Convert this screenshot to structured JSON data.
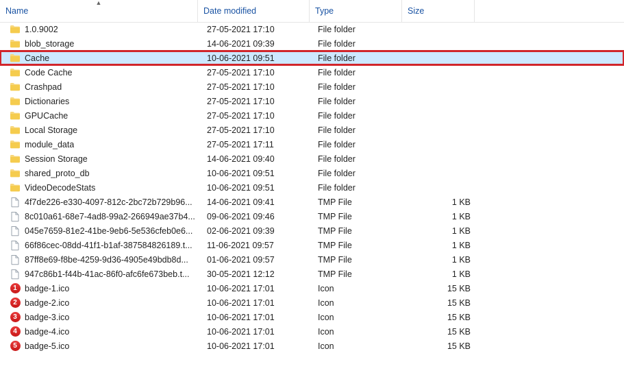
{
  "columns": {
    "name": "Name",
    "date": "Date modified",
    "type": "Type",
    "size": "Size"
  },
  "sort": {
    "column": "name",
    "direction": "asc"
  },
  "icons": {
    "folder": "folder-icon",
    "file": "file-icon",
    "badge": "badge-icon"
  },
  "items": [
    {
      "icon": "folder",
      "name": "1.0.9002",
      "date": "27-05-2021 17:10",
      "type": "File folder",
      "size": ""
    },
    {
      "icon": "folder",
      "name": "blob_storage",
      "date": "14-06-2021 09:39",
      "type": "File folder",
      "size": ""
    },
    {
      "icon": "folder",
      "name": "Cache",
      "date": "10-06-2021 09:51",
      "type": "File folder",
      "size": "",
      "selected": true,
      "highlight": true
    },
    {
      "icon": "folder",
      "name": "Code Cache",
      "date": "27-05-2021 17:10",
      "type": "File folder",
      "size": ""
    },
    {
      "icon": "folder",
      "name": "Crashpad",
      "date": "27-05-2021 17:10",
      "type": "File folder",
      "size": ""
    },
    {
      "icon": "folder",
      "name": "Dictionaries",
      "date": "27-05-2021 17:10",
      "type": "File folder",
      "size": ""
    },
    {
      "icon": "folder",
      "name": "GPUCache",
      "date": "27-05-2021 17:10",
      "type": "File folder",
      "size": ""
    },
    {
      "icon": "folder",
      "name": "Local Storage",
      "date": "27-05-2021 17:10",
      "type": "File folder",
      "size": ""
    },
    {
      "icon": "folder",
      "name": "module_data",
      "date": "27-05-2021 17:11",
      "type": "File folder",
      "size": ""
    },
    {
      "icon": "folder",
      "name": "Session Storage",
      "date": "14-06-2021 09:40",
      "type": "File folder",
      "size": ""
    },
    {
      "icon": "folder",
      "name": "shared_proto_db",
      "date": "10-06-2021 09:51",
      "type": "File folder",
      "size": ""
    },
    {
      "icon": "folder",
      "name": "VideoDecodeStats",
      "date": "10-06-2021 09:51",
      "type": "File folder",
      "size": ""
    },
    {
      "icon": "file",
      "name": "4f7de226-e330-4097-812c-2bc72b729b96...",
      "date": "14-06-2021 09:41",
      "type": "TMP File",
      "size": "1 KB"
    },
    {
      "icon": "file",
      "name": "8c010a61-68e7-4ad8-99a2-266949ae37b4...",
      "date": "09-06-2021 09:46",
      "type": "TMP File",
      "size": "1 KB"
    },
    {
      "icon": "file",
      "name": "045e7659-81e2-41be-9eb6-5e536cfeb0e6...",
      "date": "02-06-2021 09:39",
      "type": "TMP File",
      "size": "1 KB"
    },
    {
      "icon": "file",
      "name": "66f86cec-08dd-41f1-b1af-387584826189.t...",
      "date": "11-06-2021 09:57",
      "type": "TMP File",
      "size": "1 KB"
    },
    {
      "icon": "file",
      "name": "87ff8e69-f8be-4259-9d36-4905e49bdb8d...",
      "date": "01-06-2021 09:57",
      "type": "TMP File",
      "size": "1 KB"
    },
    {
      "icon": "file",
      "name": "947c86b1-f44b-41ac-86f0-afc6fe673beb.t...",
      "date": "30-05-2021 12:12",
      "type": "TMP File",
      "size": "1 KB"
    },
    {
      "icon": "badge",
      "badge": "1",
      "name": "badge-1.ico",
      "date": "10-06-2021 17:01",
      "type": "Icon",
      "size": "15 KB"
    },
    {
      "icon": "badge",
      "badge": "2",
      "name": "badge-2.ico",
      "date": "10-06-2021 17:01",
      "type": "Icon",
      "size": "15 KB"
    },
    {
      "icon": "badge",
      "badge": "3",
      "name": "badge-3.ico",
      "date": "10-06-2021 17:01",
      "type": "Icon",
      "size": "15 KB"
    },
    {
      "icon": "badge",
      "badge": "4",
      "name": "badge-4.ico",
      "date": "10-06-2021 17:01",
      "type": "Icon",
      "size": "15 KB"
    },
    {
      "icon": "badge",
      "badge": "5",
      "name": "badge-5.ico",
      "date": "10-06-2021 17:01",
      "type": "Icon",
      "size": "15 KB"
    }
  ]
}
